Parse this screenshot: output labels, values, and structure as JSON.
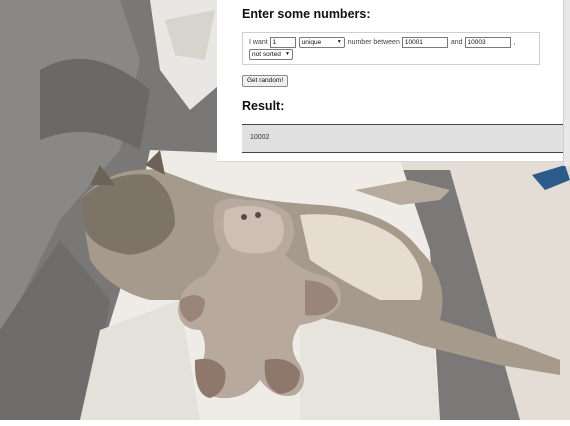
{
  "form": {
    "heading": "Enter some numbers:",
    "i_want_label": "I want",
    "count_value": "1",
    "mode_select": "unique",
    "number_between_label": "number between",
    "min_value": "10001",
    "and_label": "and",
    "max_value": "10003",
    "trailing_comma": ",",
    "sort_select": "not sorted",
    "button_label": "Get random!"
  },
  "result": {
    "heading": "Result:",
    "value": "10002"
  },
  "photo": {
    "subject": "tabby-cat-with-plush-toy"
  }
}
